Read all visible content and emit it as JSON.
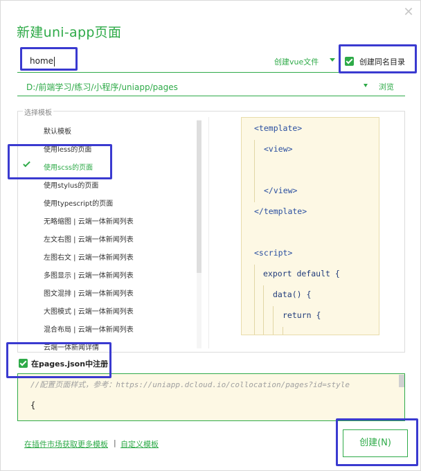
{
  "dialog": {
    "title": "新建uni-app页面",
    "close_icon": "close-icon"
  },
  "name_field": {
    "value": "home",
    "file_type": "创建vue文件"
  },
  "same_name_dir": {
    "checked": true,
    "label": "创建同名目录"
  },
  "path": {
    "value": "D:/前端学习/练习/小程序/uniapp/pages",
    "browse_label": "浏览"
  },
  "templates": {
    "caption": "选择模板",
    "selected_index": 2,
    "items": [
      {
        "label": "默认模板"
      },
      {
        "label": "使用less的页面"
      },
      {
        "label": "使用scss的页面"
      },
      {
        "label": "使用stylus的页面"
      },
      {
        "label": "使用typescript的页面"
      },
      {
        "label": "无略缩图 | 云端一体新闻列表"
      },
      {
        "label": "左文右图 | 云端一体新闻列表"
      },
      {
        "label": "左图右文 | 云端一体新闻列表"
      },
      {
        "label": "多图显示 | 云端一体新闻列表"
      },
      {
        "label": "图文混排 | 云端一体新闻列表"
      },
      {
        "label": "大图模式 | 云端一体新闻列表"
      },
      {
        "label": "混合布局 | 云端一体新闻列表"
      },
      {
        "label": "云端一体新闻详情"
      }
    ]
  },
  "preview": {
    "lines": [
      "<template>",
      "<view>",
      "",
      "</view>",
      "</template>",
      "",
      "<script>",
      "export default {",
      "data() {",
      "return {"
    ]
  },
  "register": {
    "checked": true,
    "label": "在pages.json中注册"
  },
  "json_editor": {
    "comment": "//配置页面样式，参考：https://uniapp.dcloud.io/collocation/pages?id=style",
    "first_line": "{"
  },
  "footer": {
    "market_link": "在插件市场获取更多模板",
    "separator": "|",
    "custom_link": "自定义模板",
    "create_button": "创建(N)"
  },
  "colors": {
    "accent": "#2eaa48",
    "annotation": "#3a3ad0",
    "preview_bg": "#fdf8e4"
  }
}
